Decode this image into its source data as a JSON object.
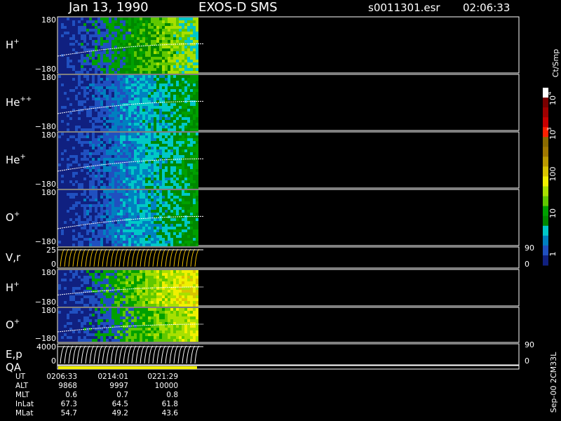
{
  "header": {
    "date": "Jan 13, 1990",
    "instrument": "EXOS-D SMS",
    "file": "s0011301.esr",
    "time": "02:06:33"
  },
  "panels": [
    {
      "id": "h_plus",
      "name": "H",
      "sup": "+",
      "ymax": "180",
      "ymin": "−180",
      "palette": "h1"
    },
    {
      "id": "he_pp",
      "name": "He",
      "sup": "++",
      "ymax": "180",
      "ymin": "−180",
      "palette": "he2"
    },
    {
      "id": "he_p",
      "name": "He",
      "sup": "+",
      "ymax": "180",
      "ymin": "−180",
      "palette": "he1"
    },
    {
      "id": "o_plus",
      "name": "O",
      "sup": "+",
      "ymax": "180",
      "ymin": "−180",
      "palette": "o1"
    },
    {
      "id": "vr",
      "name": "V,r",
      "sup": "",
      "ymax": "25",
      "ymin": "0",
      "right_top": "90",
      "right_bottom": "0"
    },
    {
      "id": "h_plus_2",
      "name": "H",
      "sup": "+",
      "ymax": "180",
      "ymin": "−180",
      "palette": "h2"
    },
    {
      "id": "o_plus_2",
      "name": "O",
      "sup": "+",
      "ymax": "180",
      "ymin": "−180",
      "palette": "o2"
    },
    {
      "id": "ep",
      "name": "E,p",
      "sup": "",
      "ymax": "4000",
      "ymin": "0",
      "right_top": "90",
      "right_bottom": "0"
    },
    {
      "id": "qa",
      "name": "QA",
      "sup": ""
    }
  ],
  "colorbar": {
    "unit": "Ct/Smp",
    "labels": [
      "10",
      "4",
      "10",
      "3",
      "100",
      "10",
      "1"
    ],
    "colors": [
      "#ffffff",
      "#7a0000",
      "#a00000",
      "#c80000",
      "#ff2000",
      "#8a6a00",
      "#a07800",
      "#bb9a00",
      "#d8c400",
      "#f0f000",
      "#a8e000",
      "#60c800",
      "#00a000",
      "#008800",
      "#00c8c8",
      "#0080c0",
      "#2050c0",
      "#102080"
    ]
  },
  "footer": {
    "rows": [
      {
        "label": "UT",
        "values": [
          "0206:33",
          "0214:01",
          "0221:29"
        ]
      },
      {
        "label": "ALT",
        "values": [
          "9868",
          "9997",
          "10000"
        ]
      },
      {
        "label": "MLT",
        "values": [
          "0.6",
          "0.7",
          "0.8"
        ]
      },
      {
        "label": "InLat",
        "values": [
          "67.3",
          "64.5",
          "61.8"
        ]
      },
      {
        "label": "MLat",
        "values": [
          "54.7",
          "49.2",
          "43.6"
        ]
      }
    ],
    "stamp": "Sep-00 2CM33L"
  },
  "chart_data": {
    "type": "heatmap",
    "title": "Jan 13, 1990   EXOS-D SMS",
    "x_ticks": [
      "0206:33",
      "0214:01",
      "0221:29"
    ],
    "series": [
      {
        "name": "H+",
        "ylim": [
          -180,
          180
        ]
      },
      {
        "name": "He++",
        "ylim": [
          -180,
          180
        ]
      },
      {
        "name": "He+",
        "ylim": [
          -180,
          180
        ]
      },
      {
        "name": "O+",
        "ylim": [
          -180,
          180
        ]
      },
      {
        "name": "V,r",
        "ylim": [
          0,
          25
        ]
      },
      {
        "name": "H+",
        "ylim": [
          -180,
          180
        ]
      },
      {
        "name": "O+",
        "ylim": [
          -180,
          180
        ]
      },
      {
        "name": "E,p",
        "ylim": [
          0,
          4000
        ]
      }
    ],
    "colorbar_scale": "log",
    "colorbar_range": [
      1,
      10000
    ]
  }
}
